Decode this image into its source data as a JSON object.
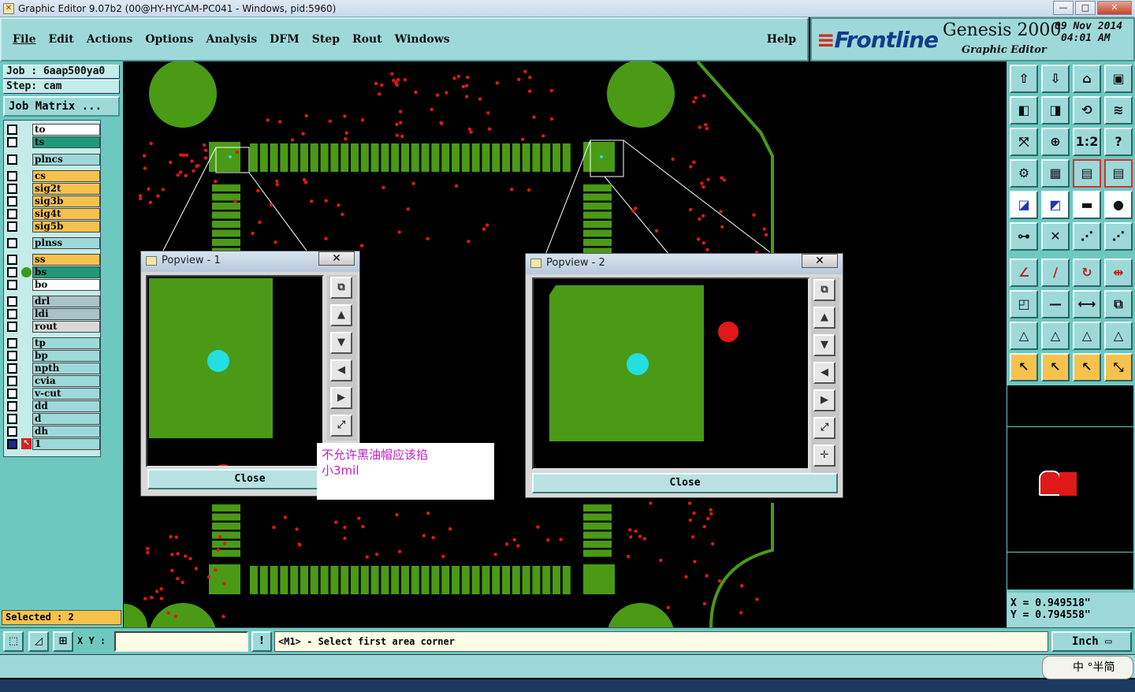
{
  "window": {
    "title": "Graphic Editor 9.07b2 (00@HY-HYCAM-PC041 - Windows, pid:5960)",
    "min": "—",
    "max": "□",
    "close": "✕"
  },
  "menu": {
    "items": [
      "File",
      "Edit",
      "Actions",
      "Options",
      "Analysis",
      "DFM",
      "Step",
      "Rout",
      "Windows"
    ],
    "help": "Help"
  },
  "brand": {
    "logo": "Frontline",
    "product": "Genesis 2000",
    "subtitle": "Graphic Editor",
    "date_line1": "09 Nov 2014",
    "date_line2": "04:01 AM"
  },
  "job": {
    "job_line": "Job : 6aap500ya0",
    "step_line": "Step: cam",
    "job_matrix": "Job Matrix ..."
  },
  "layers": [
    {
      "name": "to",
      "color": "#ffffff"
    },
    {
      "name": "ts",
      "color": "#1e9a7a"
    },
    {
      "name": "plncs",
      "color": "#9ed9d9"
    },
    {
      "name": "cs",
      "color": "#f6c24e"
    },
    {
      "name": "sig2t",
      "color": "#f6c24e"
    },
    {
      "name": "sig3b",
      "color": "#f6c24e"
    },
    {
      "name": "sig4t",
      "color": "#f6c24e"
    },
    {
      "name": "sig5b",
      "color": "#f6c24e"
    },
    {
      "name": "plnss",
      "color": "#9ed9d9"
    },
    {
      "name": "ss",
      "color": "#f6c24e"
    },
    {
      "name": "bs",
      "color": "#1e9a7a"
    },
    {
      "name": "bo",
      "color": "#ffffff"
    },
    {
      "name": "drl",
      "color": "#a8c4c8"
    },
    {
      "name": "ldi",
      "color": "#a8c4c8"
    },
    {
      "name": "rout",
      "color": "#d8d8d8"
    },
    {
      "name": "tp",
      "color": "#9ed9d9"
    },
    {
      "name": "bp",
      "color": "#9ed9d9"
    },
    {
      "name": "npth",
      "color": "#9ed9d9"
    },
    {
      "name": "cvia",
      "color": "#9ed9d9"
    },
    {
      "name": "v-cut",
      "color": "#9ed9d9"
    },
    {
      "name": "dd",
      "color": "#9ed9d9"
    },
    {
      "name": "d",
      "color": "#9ed9d9"
    },
    {
      "name": "dh",
      "color": "#9ed9d9"
    },
    {
      "name": "1",
      "color": "#9ed9d9"
    }
  ],
  "selected": "Selected : 2",
  "popview1": {
    "title": "Popview - 1",
    "close_label": "Close"
  },
  "popview2": {
    "title": "Popview - 2",
    "close_label": "Close"
  },
  "note": {
    "line1": "不允许黑油帽应该掐",
    "line2": "小3mil"
  },
  "coords": {
    "x": "X = 0.949518\"",
    "y": "Y = 0.794558\""
  },
  "status": {
    "xy_label": "X Y :",
    "prompt": "<M1> - Select first area corner",
    "unit": "Inch",
    "warn": "!"
  },
  "ime": {
    "text": "中 °半简"
  },
  "toolbar_icons": [
    "undo-icon",
    "redo-icon",
    "home-icon",
    "window-icon",
    "left-icon",
    "right-icon",
    "swap-icon",
    "s-icon",
    "fit-icon",
    "center-icon",
    "ratio-icon",
    "help-icon",
    "settings-icon",
    "grid-icon",
    "layers-icon",
    "layers2-icon",
    "measure-pad-icon",
    "measure-line-icon",
    "ruler-icon",
    "circle-icon",
    "connect-icon",
    "cross-icon",
    "point-icon",
    "point2-icon",
    "angle-icon",
    "line-icon",
    "arc-icon",
    "distance-icon",
    "pad-icon",
    "minus-icon",
    "width-icon",
    "shapes-icon",
    "tri1-icon",
    "tri2-icon",
    "tri3-icon",
    "tri4-icon",
    "select-icon",
    "select2-icon",
    "select3-icon",
    "route-icon"
  ],
  "toolbar_labels": {
    "ratio": "1:2",
    "help": "?"
  }
}
